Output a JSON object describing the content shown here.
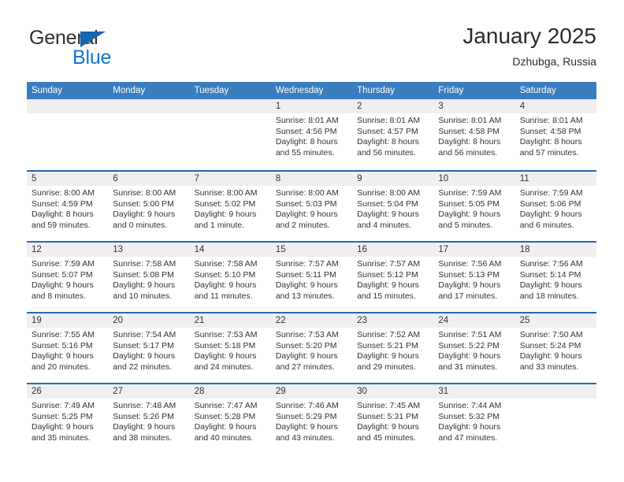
{
  "brand": {
    "name_top": "General",
    "name_bottom": "Blue",
    "triangle_color": "#1565b0",
    "blue_color": "#1277cc"
  },
  "header": {
    "title": "January 2025",
    "subtitle": "Dzhubga, Russia"
  },
  "theme": {
    "header_row_bg": "#3a7ebf",
    "row_separator": "#1f6bb0",
    "daynum_band_bg": "#efefef"
  },
  "weekdays": [
    "Sunday",
    "Monday",
    "Tuesday",
    "Wednesday",
    "Thursday",
    "Friday",
    "Saturday"
  ],
  "weeks": [
    [
      {
        "day": "",
        "empty": true
      },
      {
        "day": "",
        "empty": true
      },
      {
        "day": "",
        "empty": true
      },
      {
        "day": "1",
        "sunrise": "Sunrise: 8:01 AM",
        "sunset": "Sunset: 4:56 PM",
        "daylight1": "Daylight: 8 hours",
        "daylight2": "and 55 minutes."
      },
      {
        "day": "2",
        "sunrise": "Sunrise: 8:01 AM",
        "sunset": "Sunset: 4:57 PM",
        "daylight1": "Daylight: 8 hours",
        "daylight2": "and 56 minutes."
      },
      {
        "day": "3",
        "sunrise": "Sunrise: 8:01 AM",
        "sunset": "Sunset: 4:58 PM",
        "daylight1": "Daylight: 8 hours",
        "daylight2": "and 56 minutes."
      },
      {
        "day": "4",
        "sunrise": "Sunrise: 8:01 AM",
        "sunset": "Sunset: 4:58 PM",
        "daylight1": "Daylight: 8 hours",
        "daylight2": "and 57 minutes."
      }
    ],
    [
      {
        "day": "5",
        "sunrise": "Sunrise: 8:00 AM",
        "sunset": "Sunset: 4:59 PM",
        "daylight1": "Daylight: 8 hours",
        "daylight2": "and 59 minutes."
      },
      {
        "day": "6",
        "sunrise": "Sunrise: 8:00 AM",
        "sunset": "Sunset: 5:00 PM",
        "daylight1": "Daylight: 9 hours",
        "daylight2": "and 0 minutes."
      },
      {
        "day": "7",
        "sunrise": "Sunrise: 8:00 AM",
        "sunset": "Sunset: 5:02 PM",
        "daylight1": "Daylight: 9 hours",
        "daylight2": "and 1 minute."
      },
      {
        "day": "8",
        "sunrise": "Sunrise: 8:00 AM",
        "sunset": "Sunset: 5:03 PM",
        "daylight1": "Daylight: 9 hours",
        "daylight2": "and 2 minutes."
      },
      {
        "day": "9",
        "sunrise": "Sunrise: 8:00 AM",
        "sunset": "Sunset: 5:04 PM",
        "daylight1": "Daylight: 9 hours",
        "daylight2": "and 4 minutes."
      },
      {
        "day": "10",
        "sunrise": "Sunrise: 7:59 AM",
        "sunset": "Sunset: 5:05 PM",
        "daylight1": "Daylight: 9 hours",
        "daylight2": "and 5 minutes."
      },
      {
        "day": "11",
        "sunrise": "Sunrise: 7:59 AM",
        "sunset": "Sunset: 5:06 PM",
        "daylight1": "Daylight: 9 hours",
        "daylight2": "and 6 minutes."
      }
    ],
    [
      {
        "day": "12",
        "sunrise": "Sunrise: 7:59 AM",
        "sunset": "Sunset: 5:07 PM",
        "daylight1": "Daylight: 9 hours",
        "daylight2": "and 8 minutes."
      },
      {
        "day": "13",
        "sunrise": "Sunrise: 7:58 AM",
        "sunset": "Sunset: 5:08 PM",
        "daylight1": "Daylight: 9 hours",
        "daylight2": "and 10 minutes."
      },
      {
        "day": "14",
        "sunrise": "Sunrise: 7:58 AM",
        "sunset": "Sunset: 5:10 PM",
        "daylight1": "Daylight: 9 hours",
        "daylight2": "and 11 minutes."
      },
      {
        "day": "15",
        "sunrise": "Sunrise: 7:57 AM",
        "sunset": "Sunset: 5:11 PM",
        "daylight1": "Daylight: 9 hours",
        "daylight2": "and 13 minutes."
      },
      {
        "day": "16",
        "sunrise": "Sunrise: 7:57 AM",
        "sunset": "Sunset: 5:12 PM",
        "daylight1": "Daylight: 9 hours",
        "daylight2": "and 15 minutes."
      },
      {
        "day": "17",
        "sunrise": "Sunrise: 7:56 AM",
        "sunset": "Sunset: 5:13 PM",
        "daylight1": "Daylight: 9 hours",
        "daylight2": "and 17 minutes."
      },
      {
        "day": "18",
        "sunrise": "Sunrise: 7:56 AM",
        "sunset": "Sunset: 5:14 PM",
        "daylight1": "Daylight: 9 hours",
        "daylight2": "and 18 minutes."
      }
    ],
    [
      {
        "day": "19",
        "sunrise": "Sunrise: 7:55 AM",
        "sunset": "Sunset: 5:16 PM",
        "daylight1": "Daylight: 9 hours",
        "daylight2": "and 20 minutes."
      },
      {
        "day": "20",
        "sunrise": "Sunrise: 7:54 AM",
        "sunset": "Sunset: 5:17 PM",
        "daylight1": "Daylight: 9 hours",
        "daylight2": "and 22 minutes."
      },
      {
        "day": "21",
        "sunrise": "Sunrise: 7:53 AM",
        "sunset": "Sunset: 5:18 PM",
        "daylight1": "Daylight: 9 hours",
        "daylight2": "and 24 minutes."
      },
      {
        "day": "22",
        "sunrise": "Sunrise: 7:53 AM",
        "sunset": "Sunset: 5:20 PM",
        "daylight1": "Daylight: 9 hours",
        "daylight2": "and 27 minutes."
      },
      {
        "day": "23",
        "sunrise": "Sunrise: 7:52 AM",
        "sunset": "Sunset: 5:21 PM",
        "daylight1": "Daylight: 9 hours",
        "daylight2": "and 29 minutes."
      },
      {
        "day": "24",
        "sunrise": "Sunrise: 7:51 AM",
        "sunset": "Sunset: 5:22 PM",
        "daylight1": "Daylight: 9 hours",
        "daylight2": "and 31 minutes."
      },
      {
        "day": "25",
        "sunrise": "Sunrise: 7:50 AM",
        "sunset": "Sunset: 5:24 PM",
        "daylight1": "Daylight: 9 hours",
        "daylight2": "and 33 minutes."
      }
    ],
    [
      {
        "day": "26",
        "sunrise": "Sunrise: 7:49 AM",
        "sunset": "Sunset: 5:25 PM",
        "daylight1": "Daylight: 9 hours",
        "daylight2": "and 35 minutes."
      },
      {
        "day": "27",
        "sunrise": "Sunrise: 7:48 AM",
        "sunset": "Sunset: 5:26 PM",
        "daylight1": "Daylight: 9 hours",
        "daylight2": "and 38 minutes."
      },
      {
        "day": "28",
        "sunrise": "Sunrise: 7:47 AM",
        "sunset": "Sunset: 5:28 PM",
        "daylight1": "Daylight: 9 hours",
        "daylight2": "and 40 minutes."
      },
      {
        "day": "29",
        "sunrise": "Sunrise: 7:46 AM",
        "sunset": "Sunset: 5:29 PM",
        "daylight1": "Daylight: 9 hours",
        "daylight2": "and 43 minutes."
      },
      {
        "day": "30",
        "sunrise": "Sunrise: 7:45 AM",
        "sunset": "Sunset: 5:31 PM",
        "daylight1": "Daylight: 9 hours",
        "daylight2": "and 45 minutes."
      },
      {
        "day": "31",
        "sunrise": "Sunrise: 7:44 AM",
        "sunset": "Sunset: 5:32 PM",
        "daylight1": "Daylight: 9 hours",
        "daylight2": "and 47 minutes."
      },
      {
        "day": "",
        "empty": true
      }
    ]
  ]
}
